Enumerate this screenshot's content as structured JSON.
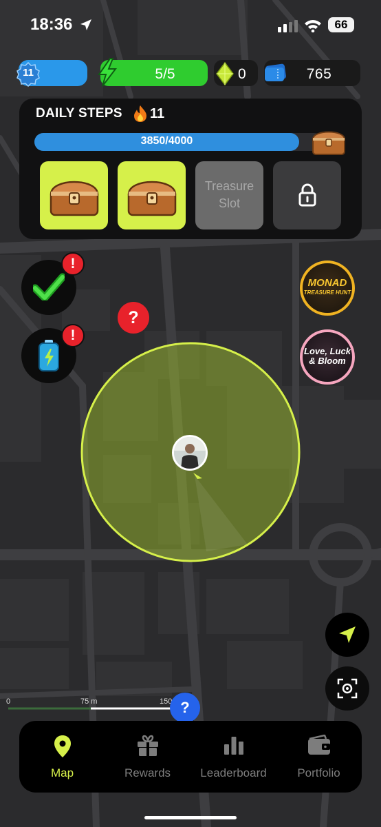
{
  "status_bar": {
    "time": "18:36",
    "battery": "66"
  },
  "stats": {
    "level": "11",
    "energy": "5/5",
    "gems": "0",
    "tickets": "765"
  },
  "daily_steps": {
    "title": "DAILY STEPS",
    "streak": "11",
    "progress_text": "3850/4000",
    "progress_fraction": 0.9625,
    "slots": [
      {
        "type": "chest"
      },
      {
        "type": "chest"
      },
      {
        "type": "empty",
        "label_line1": "Treasure",
        "label_line2": "Slot"
      },
      {
        "type": "locked"
      }
    ]
  },
  "map": {
    "question_pin": "?",
    "alert_mark": "!",
    "scale": {
      "zero": "0",
      "mid": "75 m",
      "end": "150 m"
    },
    "help": "?"
  },
  "events": {
    "monad_line1": "MONAD",
    "monad_line2": "TREASURE HUNT",
    "love_line1": "Love, Luck",
    "love_line2": "& Bloom"
  },
  "tabs": [
    {
      "label": "Map",
      "icon": "map-pin-icon",
      "active": true
    },
    {
      "label": "Rewards",
      "icon": "gift-icon",
      "active": false
    },
    {
      "label": "Leaderboard",
      "icon": "bar-chart-icon",
      "active": false
    },
    {
      "label": "Portfolio",
      "icon": "wallet-icon",
      "active": false
    }
  ],
  "colors": {
    "accent": "#d6f04a",
    "energy": "#2fcc2f",
    "progress": "#2f8fde",
    "alert": "#e8222b",
    "map_bg": "#2a2a2c"
  }
}
